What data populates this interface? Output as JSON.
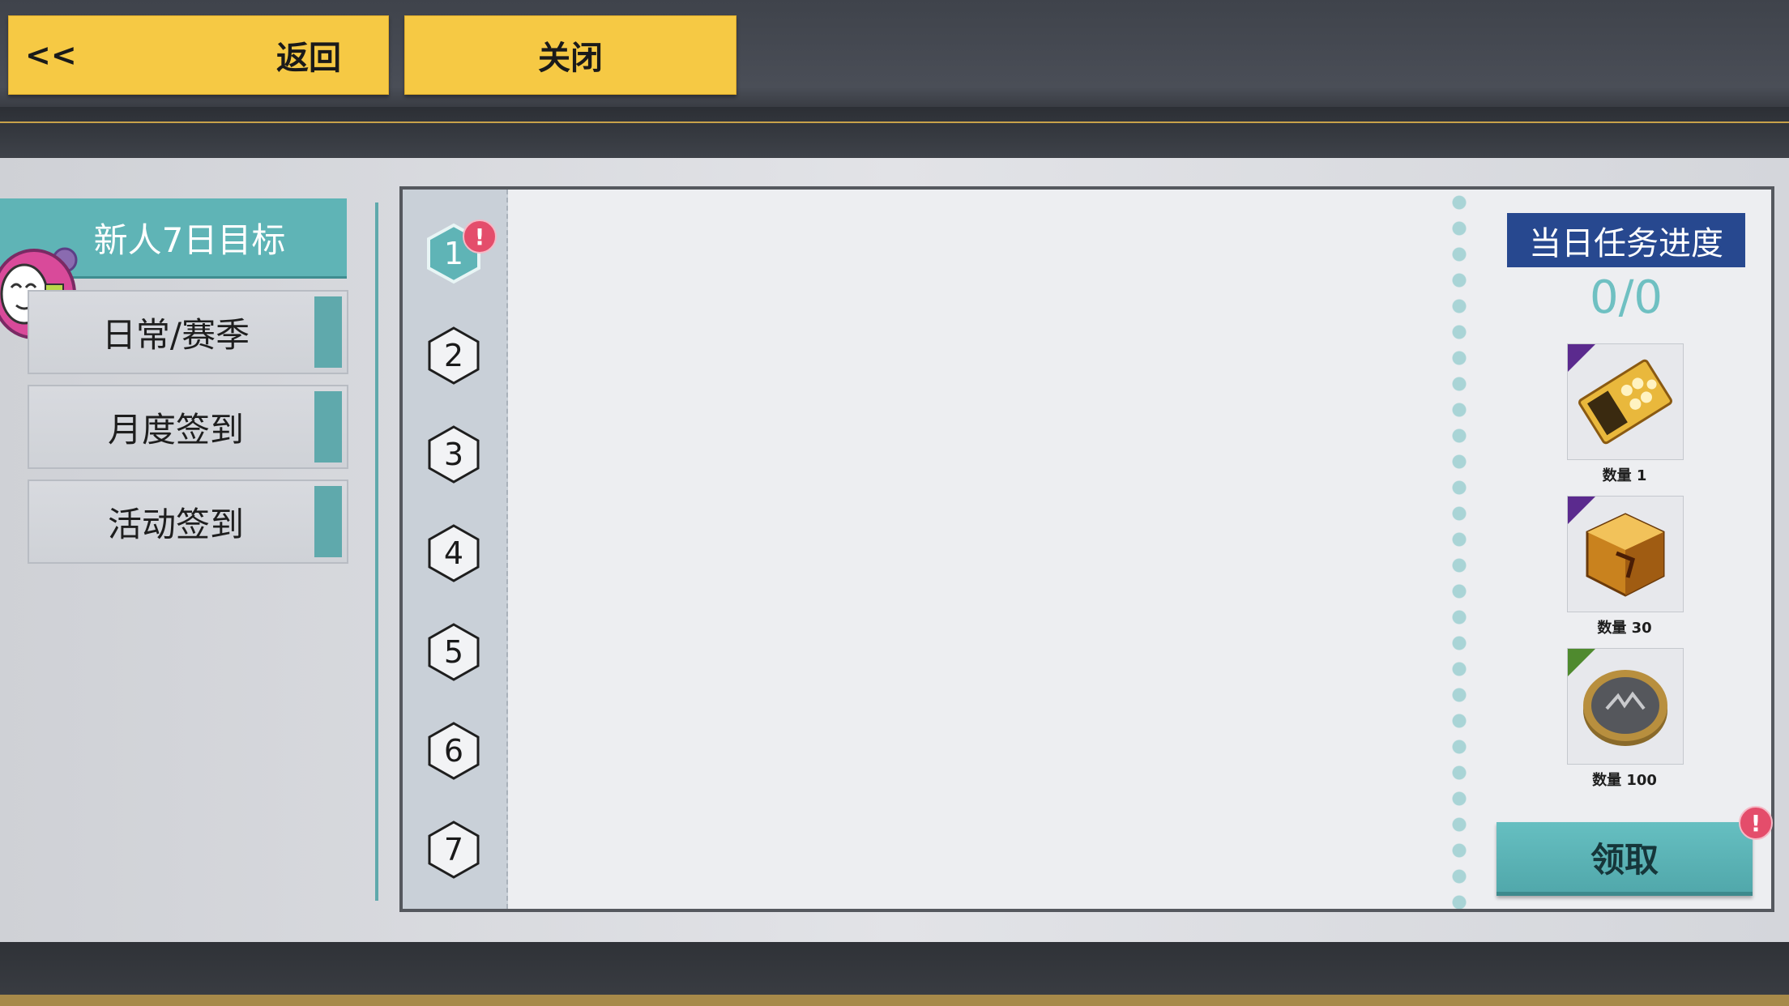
{
  "header": {
    "back_arrows": "<<",
    "back_label": "返回",
    "close_label": "关闭"
  },
  "sidebar": {
    "items": [
      {
        "label": "新人7日目标",
        "active": true
      },
      {
        "label": "日常/赛季",
        "active": false
      },
      {
        "label": "月度签到",
        "active": false
      },
      {
        "label": "活动签到",
        "active": false
      }
    ]
  },
  "days": {
    "items": [
      "1",
      "2",
      "3",
      "4",
      "5",
      "6",
      "7"
    ],
    "selected": "1",
    "alert_mark": "!"
  },
  "progress": {
    "title": "当日任务进度",
    "value": "0/0"
  },
  "rewards": [
    {
      "icon": "ticket-card-icon",
      "qty_label": "数量 1",
      "rarity_color": "#5b2a8e"
    },
    {
      "icon": "gold-cube-icon",
      "qty_label": "数量 30",
      "rarity_color": "#5b2a8e"
    },
    {
      "icon": "coin-icon",
      "qty_label": "数量 100",
      "rarity_color": "#4f8a2e"
    }
  ],
  "claim": {
    "label": "领取",
    "alert_mark": "!"
  },
  "colors": {
    "accent_teal": "#5fb4b6",
    "button_yellow": "#f6c944",
    "progress_title_bg": "#27488f",
    "alert_red": "#e44d6b"
  }
}
